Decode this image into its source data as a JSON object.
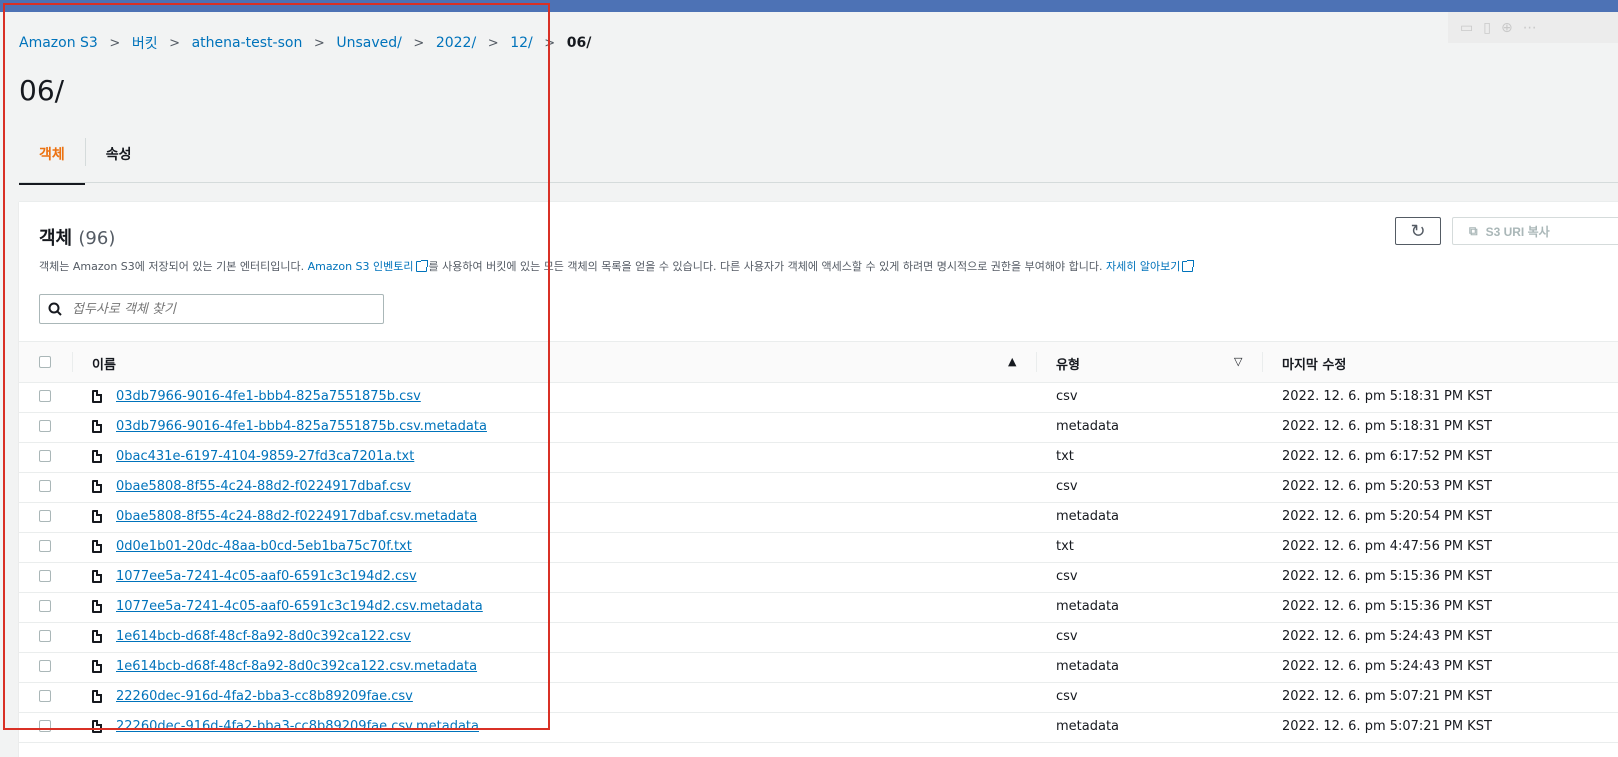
{
  "breadcrumb": [
    {
      "label": "Amazon S3",
      "link": true
    },
    {
      "label": "버킷",
      "link": true
    },
    {
      "label": "athena-test-son",
      "link": true
    },
    {
      "label": "Unsaved/",
      "link": true
    },
    {
      "label": "2022/",
      "link": true
    },
    {
      "label": "12/",
      "link": true
    },
    {
      "label": "06/",
      "link": false
    }
  ],
  "page_title": "06/",
  "tabs": [
    {
      "label": "객체",
      "active": true
    },
    {
      "label": "속성",
      "active": false
    }
  ],
  "objects": {
    "title": "객체",
    "count": "(96)",
    "desc_part1": "객체는 Amazon S3에 저장되어 있는 기본 엔터티입니다. ",
    "desc_link1": "Amazon S3 인벤토리",
    "desc_part2": "를 사용하여 버킷에 있는 모든 객체의 목록을 얻을 수 있습니다. 다른 사용자가 객체에 액세스할 수 있게 하려면 명시적으로 권한을 부여해야 합니다. ",
    "desc_link2": "자세히 알아보기",
    "copy_uri_label": "S3 URI 복사",
    "search_placeholder": "접두사로 객체 찾기"
  },
  "columns": {
    "name": "이름",
    "type": "유형",
    "modified": "마지막 수정"
  },
  "rows": [
    {
      "name": "03db7966-9016-4fe1-bbb4-825a7551875b.csv",
      "type": "csv",
      "modified": "2022. 12. 6. pm 5:18:31 PM KST"
    },
    {
      "name": "03db7966-9016-4fe1-bbb4-825a7551875b.csv.metadata",
      "type": "metadata",
      "modified": "2022. 12. 6. pm 5:18:31 PM KST"
    },
    {
      "name": "0bac431e-6197-4104-9859-27fd3ca7201a.txt",
      "type": "txt",
      "modified": "2022. 12. 6. pm 6:17:52 PM KST"
    },
    {
      "name": "0bae5808-8f55-4c24-88d2-f0224917dbaf.csv",
      "type": "csv",
      "modified": "2022. 12. 6. pm 5:20:53 PM KST"
    },
    {
      "name": "0bae5808-8f55-4c24-88d2-f0224917dbaf.csv.metadata",
      "type": "metadata",
      "modified": "2022. 12. 6. pm 5:20:54 PM KST"
    },
    {
      "name": "0d0e1b01-20dc-48aa-b0cd-5eb1ba75c70f.txt",
      "type": "txt",
      "modified": "2022. 12. 6. pm 4:47:56 PM KST"
    },
    {
      "name": "1077ee5a-7241-4c05-aaf0-6591c3c194d2.csv",
      "type": "csv",
      "modified": "2022. 12. 6. pm 5:15:36 PM KST"
    },
    {
      "name": "1077ee5a-7241-4c05-aaf0-6591c3c194d2.csv.metadata",
      "type": "metadata",
      "modified": "2022. 12. 6. pm 5:15:36 PM KST"
    },
    {
      "name": "1e614bcb-d68f-48cf-8a92-8d0c392ca122.csv",
      "type": "csv",
      "modified": "2022. 12. 6. pm 5:24:43 PM KST"
    },
    {
      "name": "1e614bcb-d68f-48cf-8a92-8d0c392ca122.csv.metadata",
      "type": "metadata",
      "modified": "2022. 12. 6. pm 5:24:43 PM KST"
    },
    {
      "name": "22260dec-916d-4fa2-bba3-cc8b89209fae.csv",
      "type": "csv",
      "modified": "2022. 12. 6. pm 5:07:21 PM KST"
    },
    {
      "name": "22260dec-916d-4fa2-bba3-cc8b89209fae.csv.metadata",
      "type": "metadata",
      "modified": "2022. 12. 6. pm 5:07:21 PM KST"
    }
  ],
  "colors": {
    "link": "#0073bb",
    "active_tab": "#ec7211",
    "highlight_box": "#d93025",
    "top_bar": "#4d72b5"
  }
}
